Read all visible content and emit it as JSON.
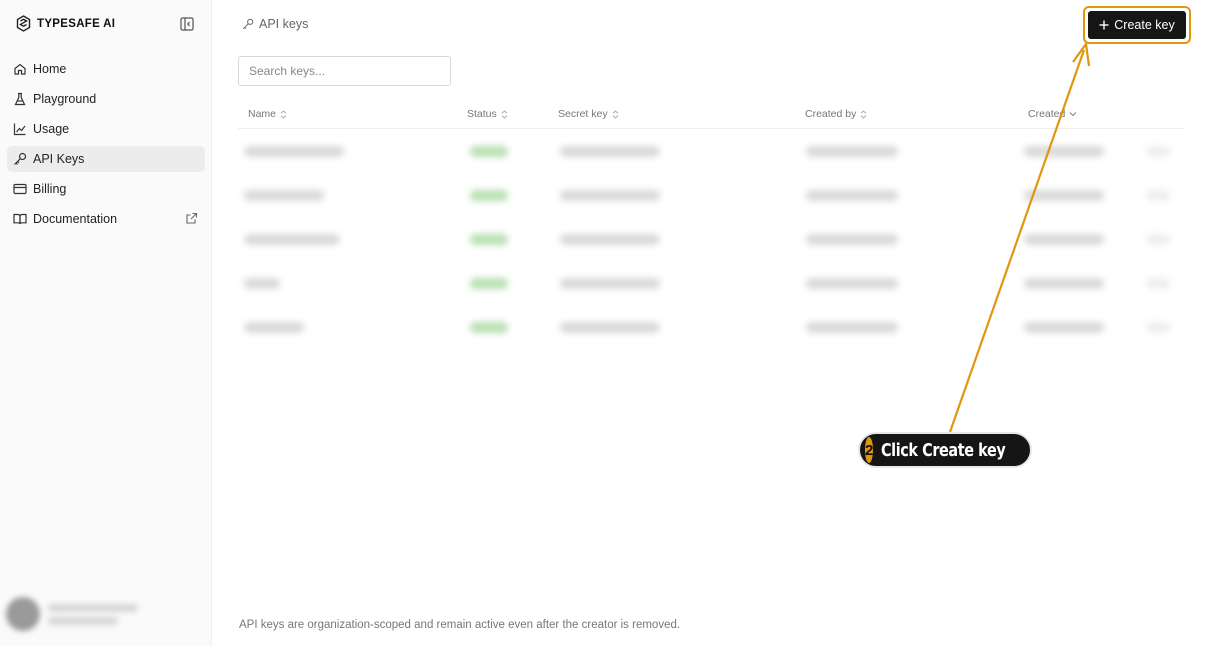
{
  "brand": {
    "name": "TYPESAFE AI"
  },
  "sidebar": {
    "items": [
      {
        "label": "Home",
        "icon": "home-icon",
        "active": false
      },
      {
        "label": "Playground",
        "icon": "flask-icon",
        "active": false
      },
      {
        "label": "Usage",
        "icon": "chart-line-icon",
        "active": false
      },
      {
        "label": "API Keys",
        "icon": "key-icon",
        "active": true
      },
      {
        "label": "Billing",
        "icon": "credit-card-icon",
        "active": false
      },
      {
        "label": "Documentation",
        "icon": "book-icon",
        "active": false,
        "external": true
      }
    ]
  },
  "header": {
    "breadcrumb": "API keys",
    "create_button_label": "Create key"
  },
  "search": {
    "placeholder": "Search keys...",
    "value": ""
  },
  "table": {
    "columns": [
      {
        "label": "Name",
        "sort": "both"
      },
      {
        "label": "Status",
        "sort": "both"
      },
      {
        "label": "Secret key",
        "sort": "both"
      },
      {
        "label": "Created by",
        "sort": "both"
      },
      {
        "label": "Created",
        "sort": "desc"
      }
    ]
  },
  "footer": {
    "note": "API keys are organization-scoped and remain active even after the creator is removed."
  },
  "annotation": {
    "step": "2",
    "text": "Click Create key"
  },
  "colors": {
    "accent": "#e0960f",
    "button": "#161616",
    "status_green": "#b9e0b2"
  }
}
